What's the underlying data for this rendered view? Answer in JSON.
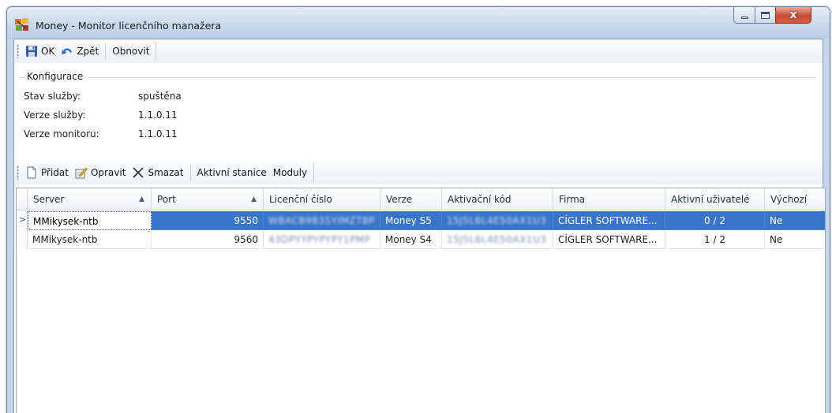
{
  "window": {
    "title": "Money - Monitor licenčního manažera",
    "close_glyph": "x"
  },
  "toolbar": {
    "ok_label": "OK",
    "back_label": "Zpět",
    "refresh_label": "Obnovit"
  },
  "config": {
    "group_title": "Konfigurace",
    "rows": [
      {
        "label": "Stav služby:",
        "value": "spuštěna"
      },
      {
        "label": "Verze služby:",
        "value": "1.1.0.11"
      },
      {
        "label": "Verze monitoru:",
        "value": "1.1.0.11"
      }
    ]
  },
  "grid_toolbar": {
    "add_label": "Přidat",
    "edit_label": "Opravit",
    "delete_label": "Smazat",
    "stations_label": "Aktivní stanice",
    "modules_label": "Moduly"
  },
  "grid": {
    "columns": [
      "Server",
      "Port",
      "Licenční číslo",
      "Verze",
      "Aktivační kód",
      "Firma",
      "Aktivní uživatelé",
      "Výchozí"
    ],
    "sort_arrow": "▲",
    "row_pointer": ">",
    "rows": [
      {
        "server": "MMikysek-ntb",
        "port": "9550",
        "license": "WBACB9835YIMZT8P",
        "version": "Money S5",
        "activation": "15J5L6L4E50AX1U3",
        "company": "CÍGLER SOFTWARE...",
        "users": "0 / 2",
        "default": "Ne"
      },
      {
        "server": "MMikysek-ntb",
        "port": "9560",
        "license": "43DPYYPYPYPY1PMP",
        "version": "Money S4",
        "activation": "15J5L6L4E50AX1U3",
        "company": "CÍGLER SOFTWARE...",
        "users": "1 / 2",
        "default": "Ne"
      }
    ]
  },
  "colors": {
    "selection": "#3874c7",
    "title_bar": "#c9d9ec",
    "close_button": "#c94c35"
  }
}
